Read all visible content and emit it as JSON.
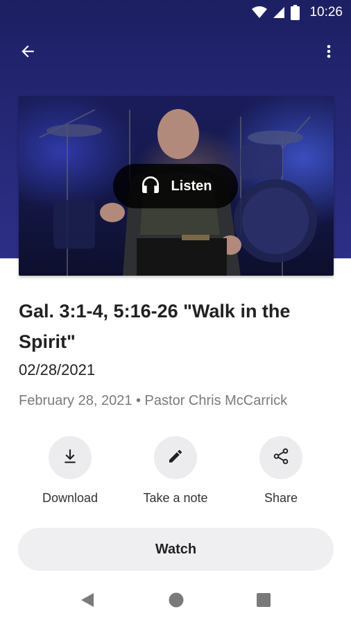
{
  "status_bar": {
    "time": "10:26",
    "icons": [
      "wifi-icon",
      "cell-signal-icon",
      "battery-icon"
    ]
  },
  "app_bar": {
    "back_icon": "arrow-left-icon",
    "menu_icon": "more-vertical-icon"
  },
  "media": {
    "listen_label": "Listen",
    "listen_icon": "headphones-icon"
  },
  "sermon": {
    "title": "Gal. 3:1-4, 5:16-26 \"Walk in the Spirit\"",
    "date_short": "02/28/2021",
    "meta": "February 28, 2021 • Pastor Chris McCarrick"
  },
  "actions": [
    {
      "label": "Download",
      "icon": "download-icon"
    },
    {
      "label": "Take a note",
      "icon": "pencil-icon"
    },
    {
      "label": "Share",
      "icon": "share-icon"
    }
  ],
  "watch_label": "Watch",
  "nav": [
    "back-triangle-icon",
    "home-circle-icon",
    "recents-square-icon"
  ],
  "colors": {
    "header_bg": "#27297a",
    "listen_bg": "#000000",
    "button_bg": "#efeff1"
  }
}
